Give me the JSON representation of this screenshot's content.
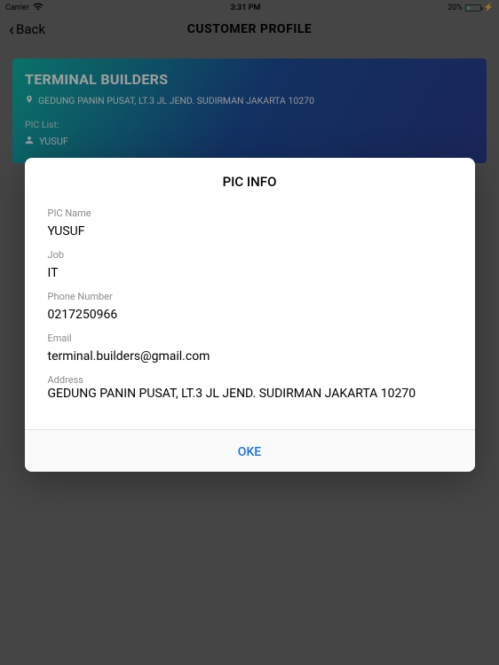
{
  "status_bar": {
    "carrier": "Carrier",
    "time": "3:31 PM",
    "battery": "20%"
  },
  "nav": {
    "back_label": "Back",
    "title": "CUSTOMER PROFILE"
  },
  "customer": {
    "name": "TERMINAL BUILDERS",
    "address": "GEDUNG PANIN PUSAT, LT.3 JL JEND. SUDIRMAN JAKARTA 10270",
    "pic_list_label": "PIC List:",
    "pic_items": [
      "YUSUF"
    ]
  },
  "modal": {
    "title": "PIC INFO",
    "fields": {
      "pic_name": {
        "label": "PIC Name",
        "value": "YUSUF"
      },
      "job": {
        "label": "Job",
        "value": "IT"
      },
      "phone": {
        "label": "Phone Number",
        "value": "0217250966"
      },
      "email": {
        "label": "Email",
        "value": "terminal.builders@gmail.com"
      },
      "address": {
        "label": "Address",
        "value": "GEDUNG PANIN PUSAT, LT.3 JL JEND. SUDIRMAN JAKARTA 10270"
      }
    },
    "ok_label": "OKE"
  }
}
